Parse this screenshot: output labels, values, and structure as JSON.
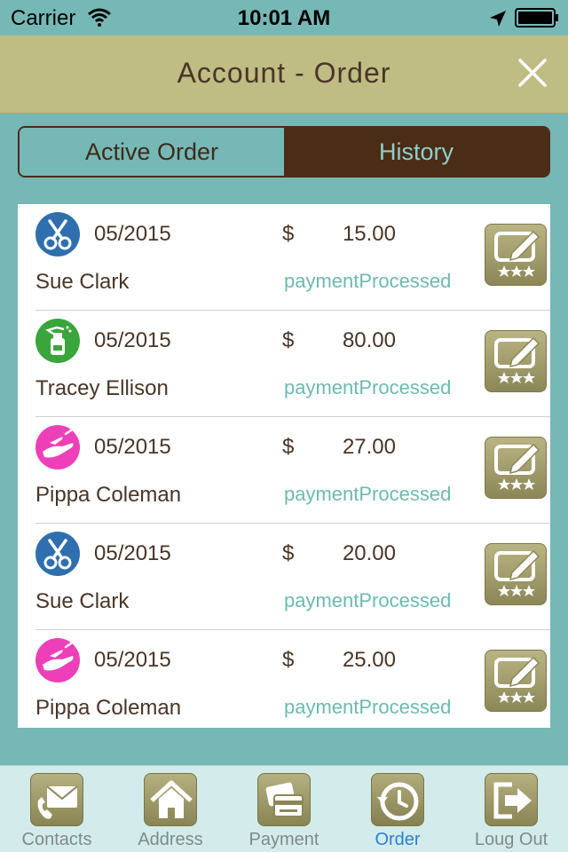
{
  "status_bar": {
    "carrier": "Carrier",
    "time": "10:01 AM"
  },
  "nav": {
    "title": "Account - Order",
    "close_icon": "close-icon"
  },
  "segments": {
    "active_label": "Active Order",
    "history_label": "History",
    "selected": "Active Order"
  },
  "orders": [
    {
      "service_icon": "scissors-icon",
      "icon_color": "#2f6fae",
      "date": "05/2015",
      "currency": "$",
      "amount": "15.00",
      "name": "Sue Clark",
      "status": "paymentProcessed"
    },
    {
      "service_icon": "spray-bottle-icon",
      "icon_color": "#3aa53a",
      "date": "05/2015",
      "currency": "$",
      "amount": "80.00",
      "name": "Tracey Ellison",
      "status": "paymentProcessed"
    },
    {
      "service_icon": "hand-nails-icon",
      "icon_color": "#ec3fb8",
      "date": "05/2015",
      "currency": "$",
      "amount": "27.00",
      "name": "Pippa Coleman",
      "status": "paymentProcessed"
    },
    {
      "service_icon": "scissors-icon",
      "icon_color": "#2f6fae",
      "date": "05/2015",
      "currency": "$",
      "amount": "20.00",
      "name": "Sue Clark",
      "status": "paymentProcessed"
    },
    {
      "service_icon": "hand-nails-icon",
      "icon_color": "#ec3fb8",
      "date": "05/2015",
      "currency": "$",
      "amount": "25.00",
      "name": "Pippa Coleman",
      "status": "paymentProcessed"
    }
  ],
  "tabs": [
    {
      "label": "Contacts",
      "icon": "contacts-icon",
      "selected": false
    },
    {
      "label": "Address",
      "icon": "home-icon",
      "selected": false
    },
    {
      "label": "Payment",
      "icon": "payment-card-icon",
      "selected": false
    },
    {
      "label": "Order",
      "icon": "history-clock-icon",
      "selected": true
    },
    {
      "label": "Loug Out",
      "icon": "logout-icon",
      "selected": false
    }
  ],
  "colors": {
    "background": "#76b8b6",
    "nav_bar": "#bfbc84",
    "dark_brown": "#4a2c17",
    "status_text": "#6cbab2",
    "tab_selected": "#2a7fd4"
  }
}
